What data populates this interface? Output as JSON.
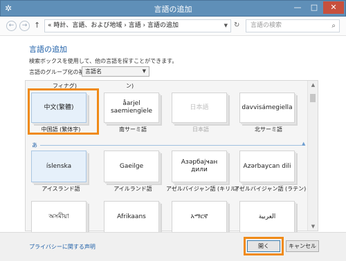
{
  "window": {
    "title": "言語の追加",
    "icon": "globe-icon",
    "minimize": "—",
    "maximize": "□",
    "close": "✕"
  },
  "nav": {
    "back": "←",
    "forward": "→",
    "up": "↑",
    "breadcrumb": "« 時計、言語、および地域 › 言語 › 言語の追加",
    "refresh": "↻",
    "search_placeholder": "言語の検索",
    "search_icon": "search-icon"
  },
  "page": {
    "heading": "言語の追加",
    "description": "検索ボックスを使用して、他の言語を探すことができます。",
    "group_label": "言語のグループ化の基準:",
    "group_value": "言語名"
  },
  "partial_row": {
    "left": "フィナグ)",
    "right": "ン)"
  },
  "row1": [
    {
      "native": "中文(繁體)",
      "caption": "中国語 (繁体字)",
      "selected": true,
      "disabled": false
    },
    {
      "native": "åarjel saemiengïele",
      "caption": "南サーミ語",
      "selected": false,
      "disabled": false
    },
    {
      "native": "日本語",
      "caption": "日本語",
      "selected": false,
      "disabled": true
    },
    {
      "native": "davvisámegiella",
      "caption": "北サーミ語",
      "selected": false,
      "disabled": false
    }
  ],
  "section": {
    "letter": "あ",
    "caret": "▲"
  },
  "row2": [
    {
      "native": "íslenska",
      "caption": "アイスランド語",
      "selected": true
    },
    {
      "native": "Gaeilge",
      "caption": "アイルランド語",
      "selected": false
    },
    {
      "native": "Азәрбајҹан дили",
      "caption": "アゼルバイジャン語 (キリル)",
      "selected": false
    },
    {
      "native": "Azərbaycan dili",
      "caption": "アゼルバイジャン語 (ラテン)",
      "selected": false
    }
  ],
  "row3": [
    {
      "native": "অসমীয়া"
    },
    {
      "native": "Afrikaans"
    },
    {
      "native": "አማርኛ"
    },
    {
      "native": "العربية"
    }
  ],
  "footer": {
    "privacy_link": "プライバシーに関する声明",
    "open_button": "開く",
    "cancel_button": "キャンセル"
  },
  "colors": {
    "title_bar": "#5f8fb8",
    "link": "#1e5fa8",
    "highlight": "#f08a17",
    "selected_tile": "#e6f0fa"
  }
}
